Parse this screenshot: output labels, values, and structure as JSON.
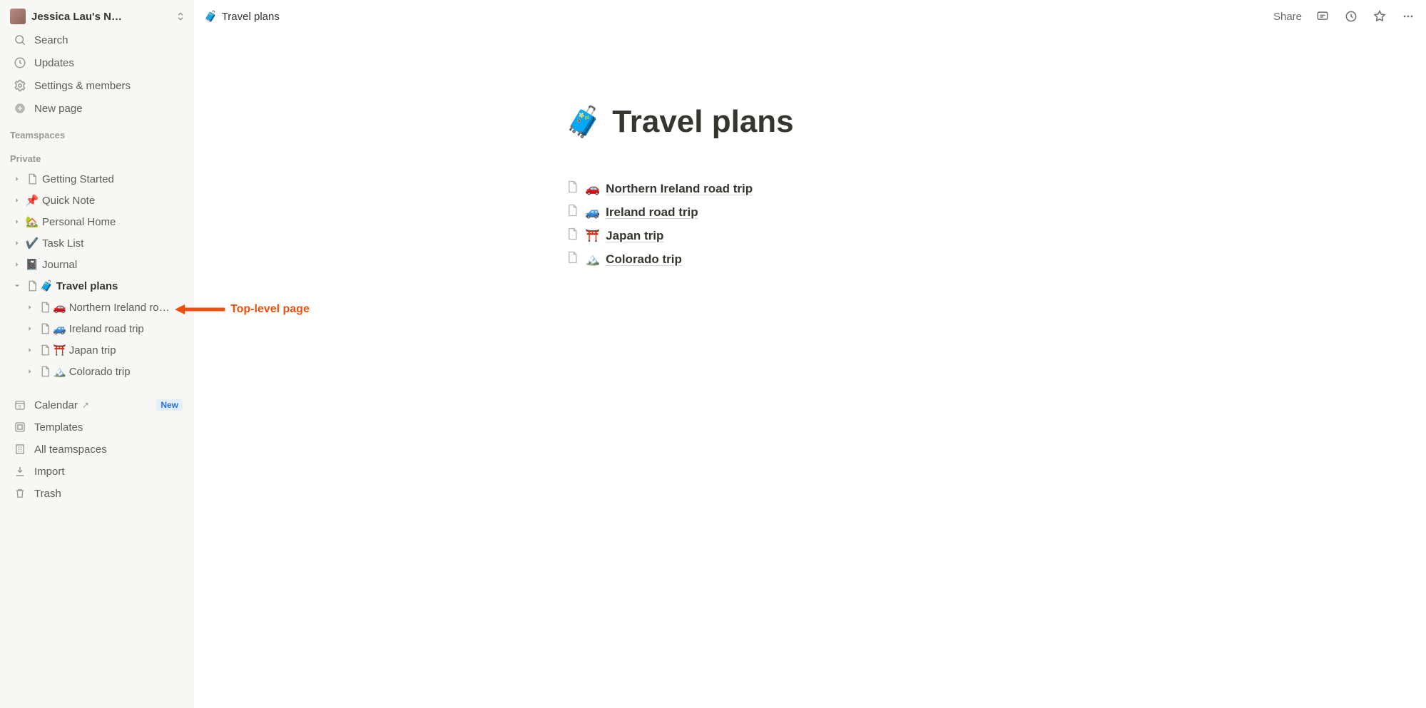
{
  "workspace": {
    "name": "Jessica Lau's N…"
  },
  "sidebar_top": {
    "search": "Search",
    "updates": "Updates",
    "settings": "Settings & members",
    "new_page": "New page"
  },
  "sections": {
    "teamspaces": "Teamspaces",
    "private": "Private"
  },
  "private_pages": [
    {
      "emoji": "",
      "doc": true,
      "label": "Getting Started"
    },
    {
      "emoji": "📌",
      "label": "Quick Note"
    },
    {
      "emoji": "🏡",
      "label": "Personal Home"
    },
    {
      "emoji": "✔️",
      "label": "Task List"
    },
    {
      "emoji": "📓",
      "label": "Journal"
    }
  ],
  "travel": {
    "emoji": "🧳",
    "label": "Travel plans",
    "children": [
      {
        "emoji": "🚗",
        "label": "Northern Ireland ro…"
      },
      {
        "emoji": "🚙",
        "label": "Ireland road trip"
      },
      {
        "emoji": "⛩️",
        "label": "Japan trip"
      },
      {
        "emoji": "🏔️",
        "label": "Colorado trip"
      }
    ]
  },
  "sidebar_bottom": {
    "calendar": "Calendar",
    "new_badge": "New",
    "templates": "Templates",
    "all_teamspaces": "All teamspaces",
    "import": "Import",
    "trash": "Trash"
  },
  "breadcrumb": {
    "emoji": "🧳",
    "label": "Travel plans"
  },
  "top_actions": {
    "share": "Share"
  },
  "page": {
    "emoji": "🧳",
    "title": "Travel plans",
    "subpages": [
      {
        "emoji": "🚗",
        "label": "Northern Ireland road trip"
      },
      {
        "emoji": "🚙",
        "label": "Ireland road trip"
      },
      {
        "emoji": "⛩️",
        "label": "Japan trip"
      },
      {
        "emoji": "🏔️",
        "label": "Colorado trip"
      }
    ]
  },
  "annotation": {
    "text": "Top-level page"
  }
}
